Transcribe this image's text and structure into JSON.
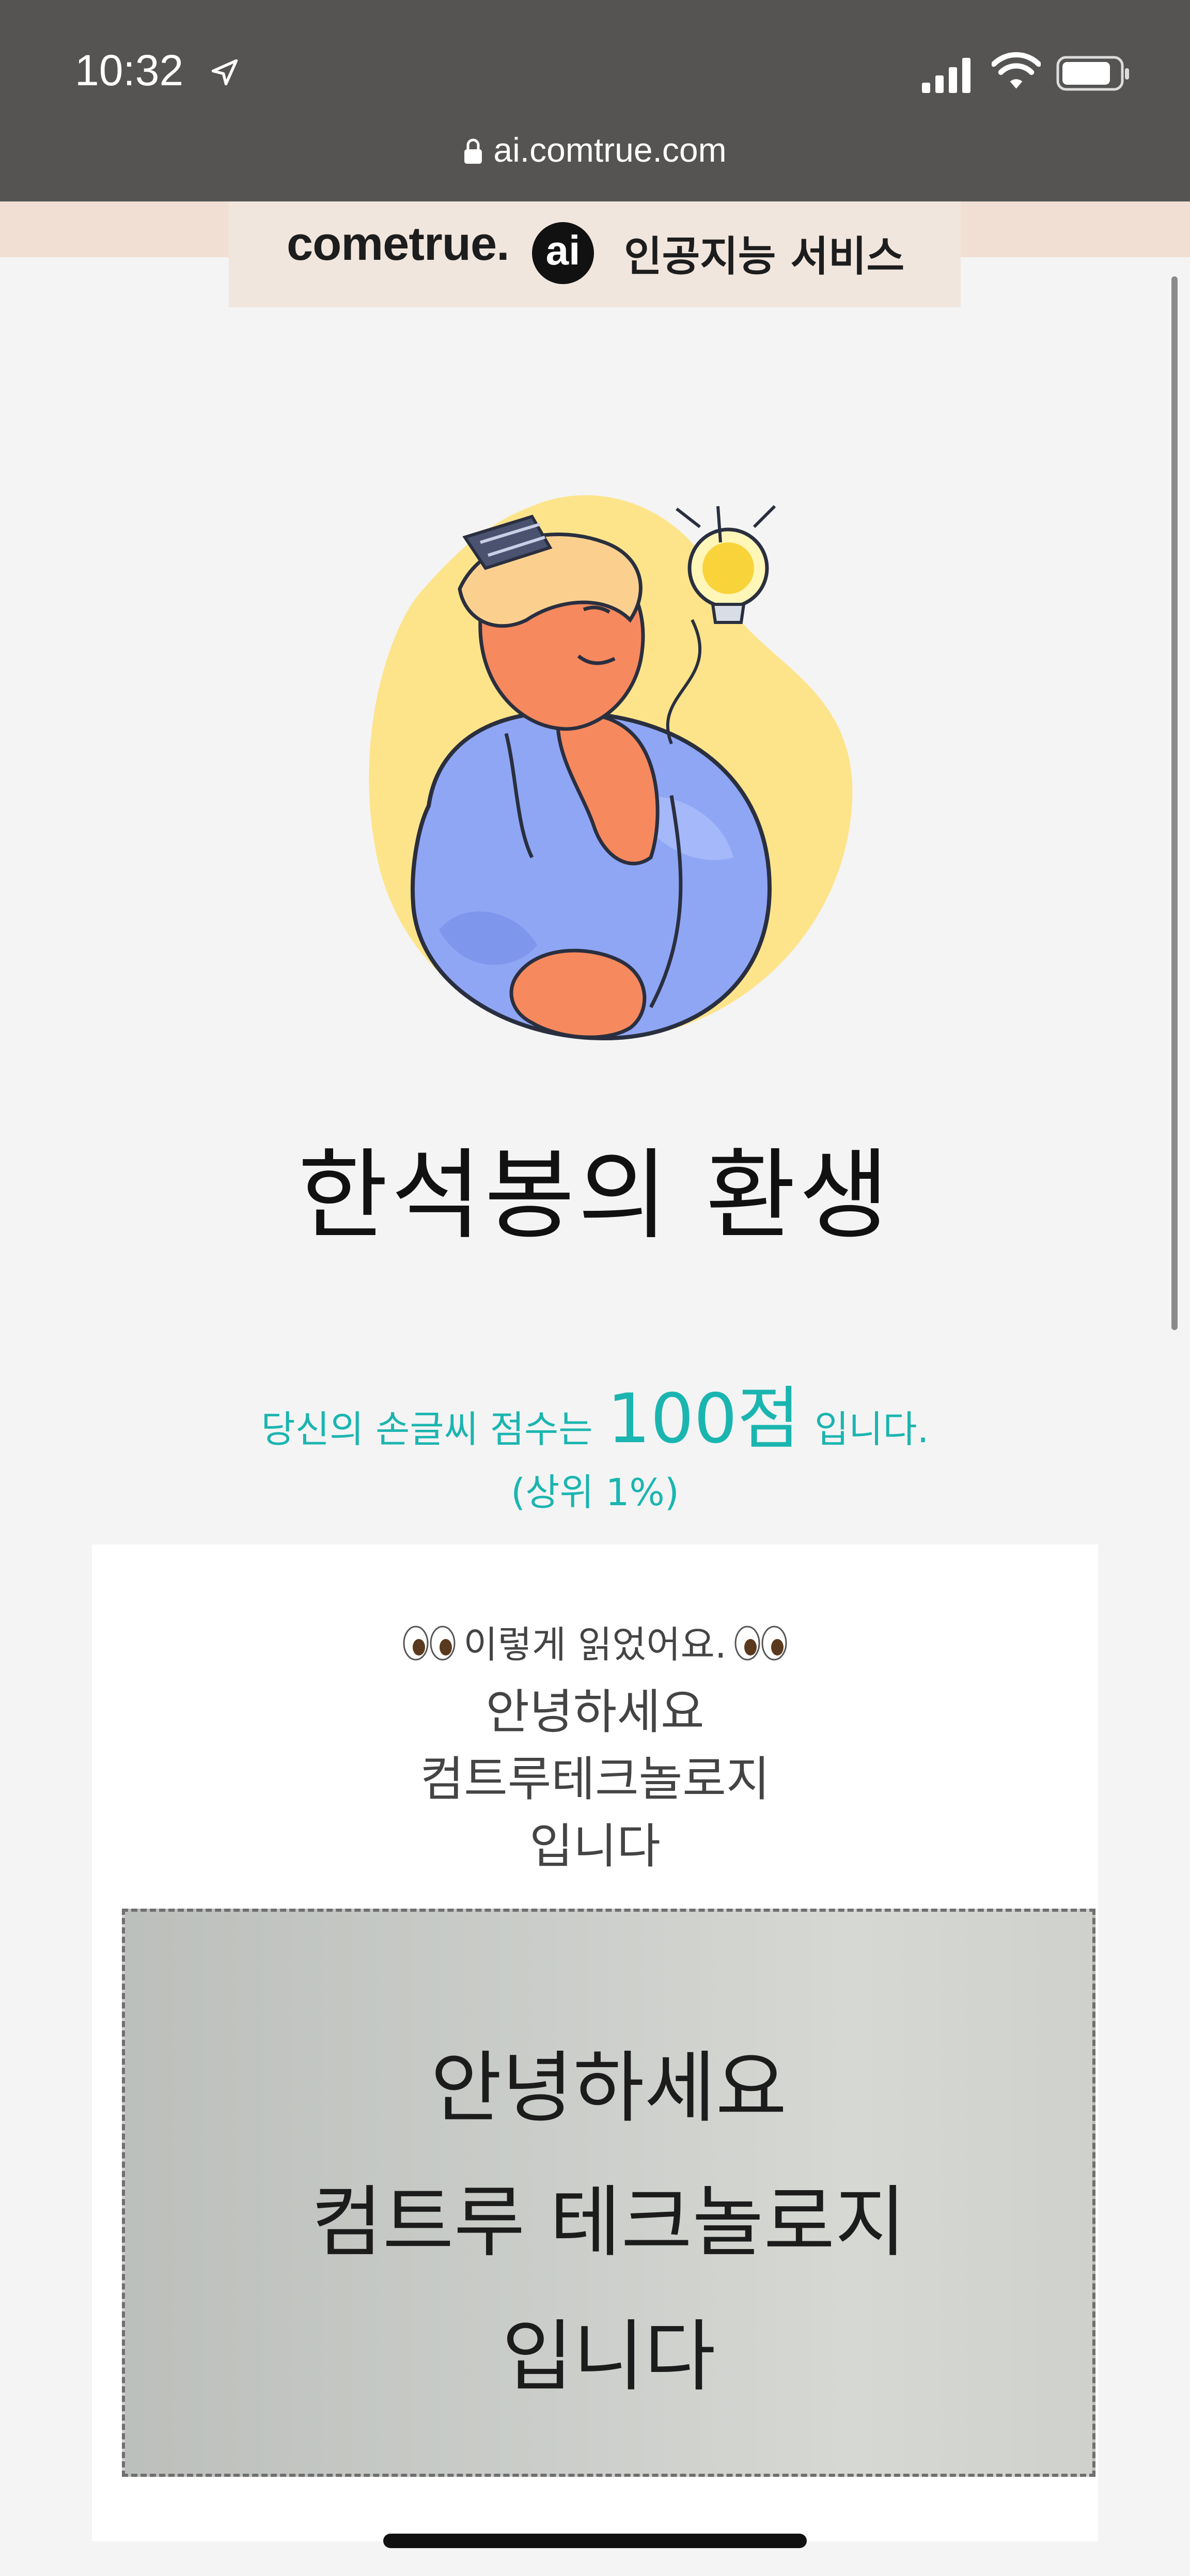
{
  "status_bar": {
    "time": "10:32",
    "url": "ai.comtrue.com"
  },
  "banner": {
    "brand": "cometrue.",
    "brand_ai": "ai",
    "service": "인공지능 서비스"
  },
  "title": "한석봉의 환생",
  "score": {
    "prefix": "당신의 손글씨 점수는",
    "value": "100점",
    "suffix": "입니다.",
    "rank": "(상위 1%)",
    "score_percent": 100
  },
  "result": {
    "label": "이렇게 읽었어요.",
    "lines": [
      "안녕하세요",
      "컴트루테크놀로지",
      "입니다"
    ]
  },
  "handwriting_photo": {
    "lines": [
      "안녕하세요",
      "컴트루 테크놀로지",
      "입니다"
    ]
  },
  "colors": {
    "accent": "#1bb5b0",
    "status_bar": "#555453",
    "banner": "#f1dfd3"
  }
}
